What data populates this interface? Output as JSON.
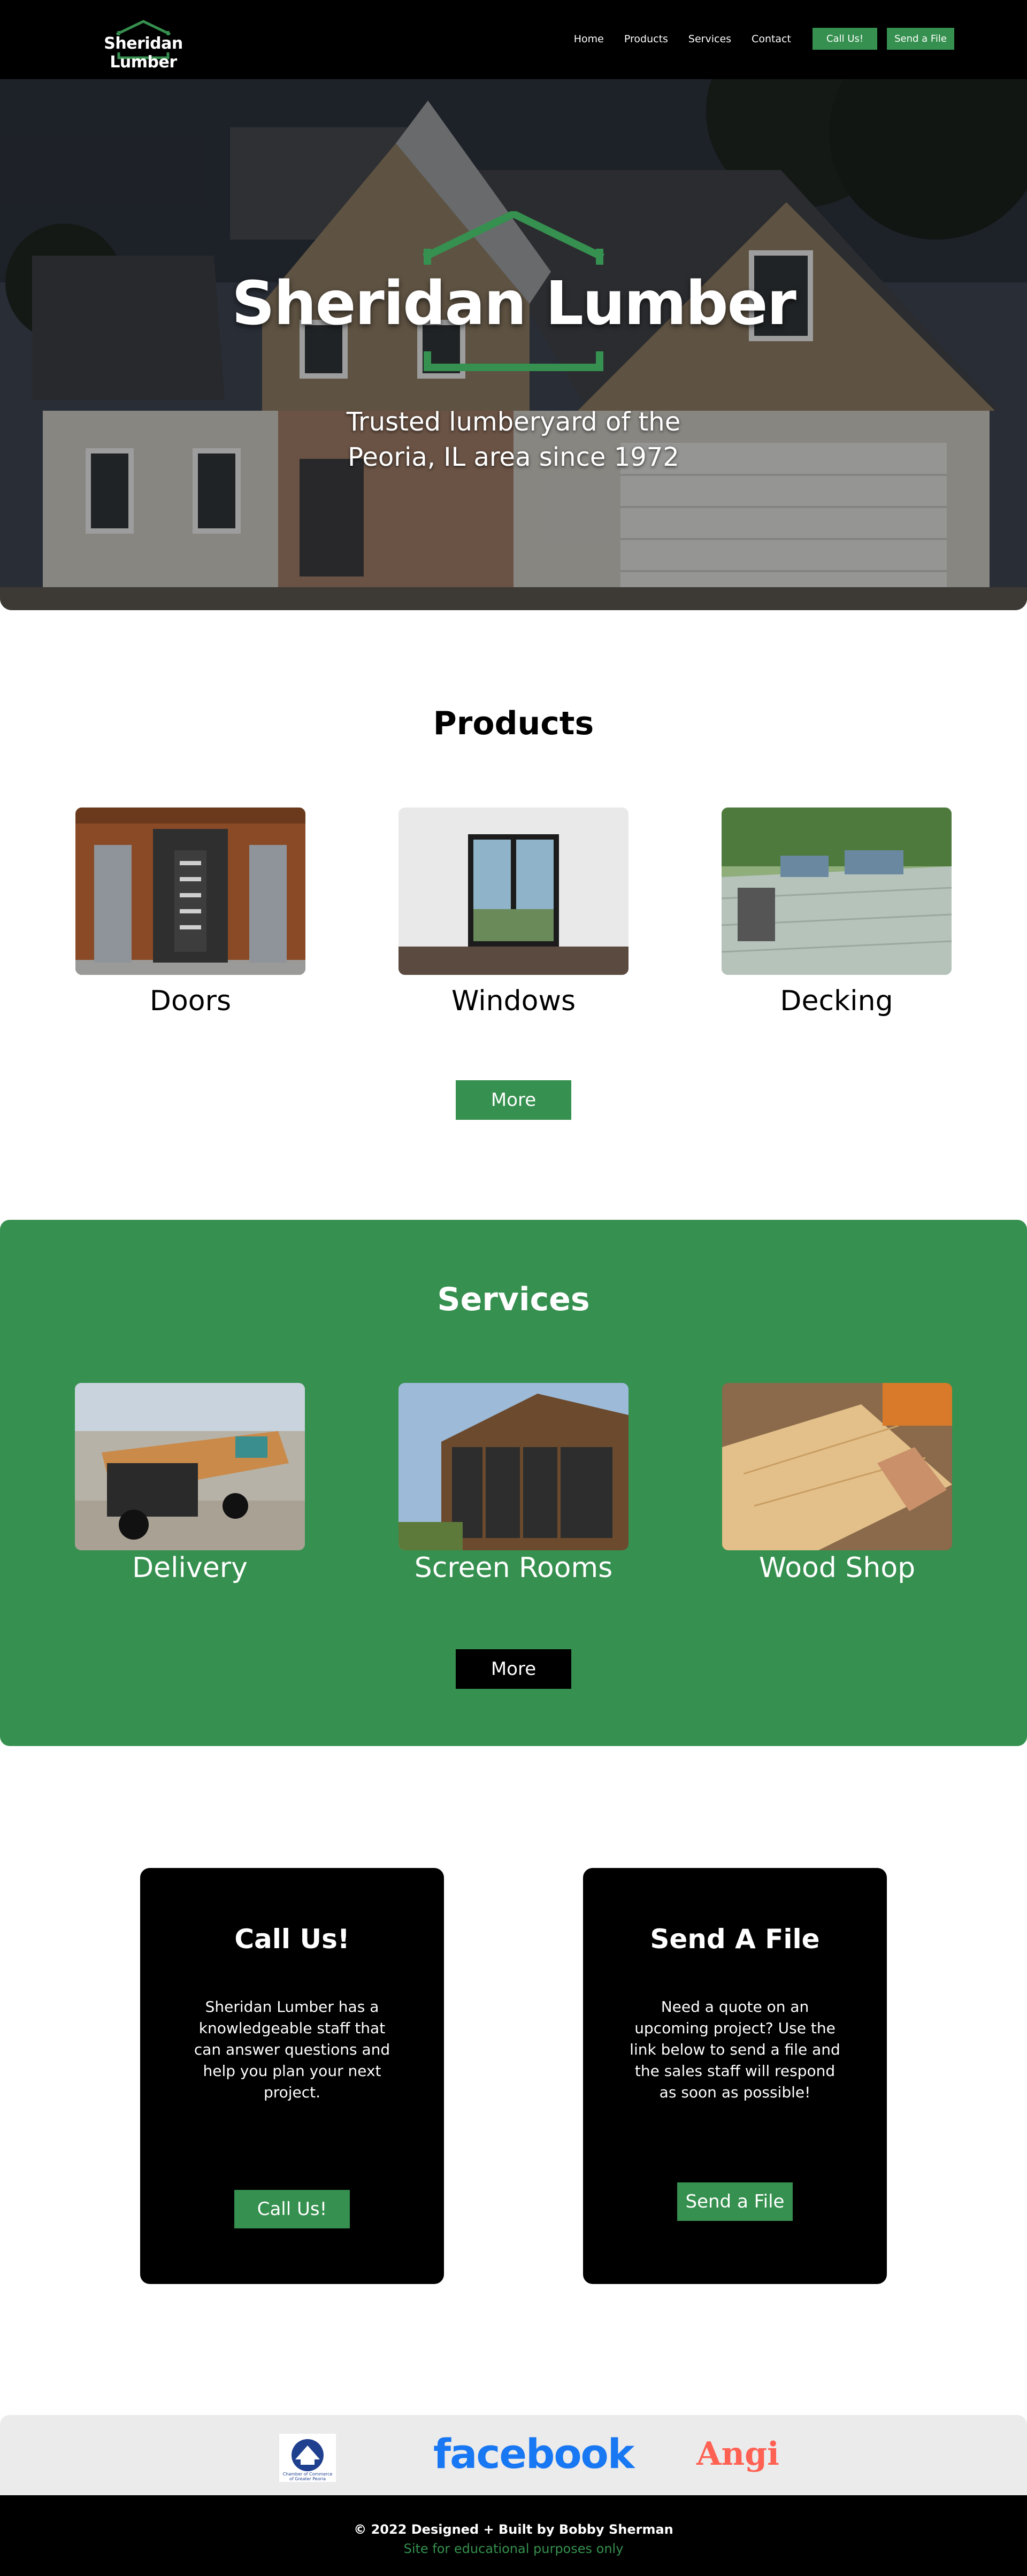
{
  "brand": {
    "name": "Sheridan Lumber",
    "green": "#36904f",
    "black": "#000000"
  },
  "nav": {
    "links": [
      "Home",
      "Products",
      "Services",
      "Contact"
    ],
    "call_button": "Call Us!",
    "file_button": "Send a File"
  },
  "hero": {
    "title": "Sheridan Lumber",
    "subtitle": "Trusted lumberyard of the Peoria, IL area since 1972"
  },
  "products": {
    "title": "Products",
    "items": [
      {
        "label": "Doors",
        "image": "front-door-photo"
      },
      {
        "label": "Windows",
        "image": "window-room-photo"
      },
      {
        "label": "Decking",
        "image": "deck-patio-photo"
      }
    ],
    "more_label": "More"
  },
  "services": {
    "title": "Services",
    "items": [
      {
        "label": "Delivery",
        "image": "delivery-truck-photo"
      },
      {
        "label": "Screen Rooms",
        "image": "screen-room-photo"
      },
      {
        "label": "Wood Shop",
        "image": "wood-shop-photo"
      }
    ],
    "more_label": "More"
  },
  "contact": {
    "call": {
      "title": "Call Us!",
      "text": "Sheridan Lumber has a knowledgeable staff that can answer questions and help you plan your next project.",
      "button": "Call Us!"
    },
    "file": {
      "title": "Send A File",
      "text": "Need a quote on an upcoming project? Use the link below to send a file and the sales staff will respond as soon as possible!",
      "button": "Send a File"
    }
  },
  "partners": {
    "chamber_lines": [
      "Chamber of Commerce",
      "of Greater Peoria"
    ],
    "facebook": "facebook",
    "angi": "Angi"
  },
  "footer": {
    "copyright": "© 2022 Designed + Built by Bobby Sherman",
    "note": "Site for educational purposes only"
  }
}
